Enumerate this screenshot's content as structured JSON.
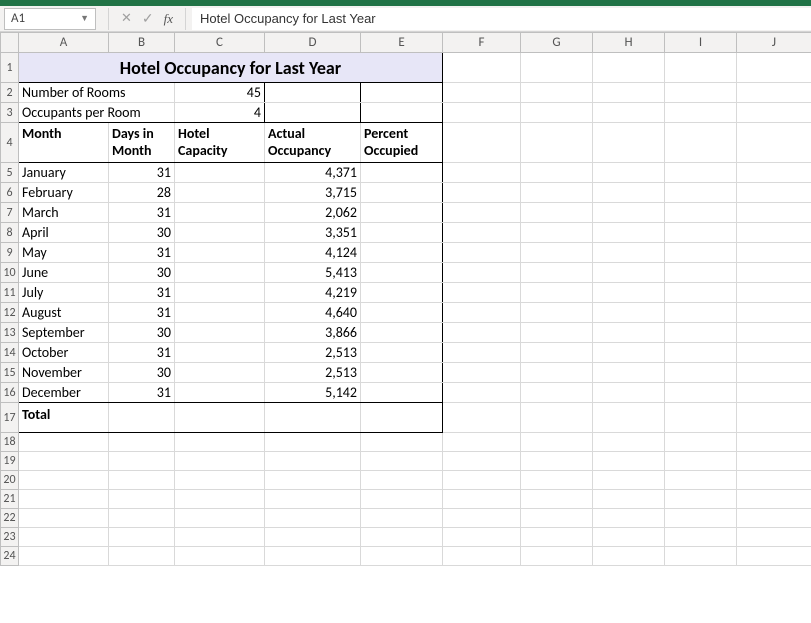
{
  "namebox": {
    "ref": "A1"
  },
  "formula_bar": {
    "fx": "fx",
    "value": "Hotel Occupancy for Last Year"
  },
  "columns": [
    "A",
    "B",
    "C",
    "D",
    "E",
    "F",
    "G",
    "H",
    "I",
    "J"
  ],
  "row_numbers": [
    "1",
    "2",
    "3",
    "4",
    "5",
    "6",
    "7",
    "8",
    "9",
    "10",
    "11",
    "12",
    "13",
    "14",
    "15",
    "16",
    "17",
    "18",
    "19",
    "20",
    "21",
    "22",
    "23",
    "24"
  ],
  "title": "Hotel Occupancy for Last Year",
  "labels": {
    "num_rooms": "Number of Rooms",
    "occ_per_room": "Occupants per Room",
    "month": "Month",
    "days": "Days in Month",
    "capacity": "Hotel Capacity",
    "actual": "Actual Occupancy",
    "percent": "Percent Occupied",
    "total": "Total"
  },
  "values": {
    "num_rooms": "45",
    "occ_per_room": "4"
  },
  "months": [
    {
      "name": "January",
      "days": "31",
      "actual": "4,371"
    },
    {
      "name": "February",
      "days": "28",
      "actual": "3,715"
    },
    {
      "name": "March",
      "days": "31",
      "actual": "2,062"
    },
    {
      "name": "April",
      "days": "30",
      "actual": "3,351"
    },
    {
      "name": "May",
      "days": "31",
      "actual": "4,124"
    },
    {
      "name": "June",
      "days": "30",
      "actual": "5,413"
    },
    {
      "name": "July",
      "days": "31",
      "actual": "4,219"
    },
    {
      "name": "August",
      "days": "31",
      "actual": "4,640"
    },
    {
      "name": "September",
      "days": "30",
      "actual": "3,866"
    },
    {
      "name": "October",
      "days": "31",
      "actual": "2,513"
    },
    {
      "name": "November",
      "days": "30",
      "actual": "2,513"
    },
    {
      "name": "December",
      "days": "31",
      "actual": "5,142"
    }
  ]
}
